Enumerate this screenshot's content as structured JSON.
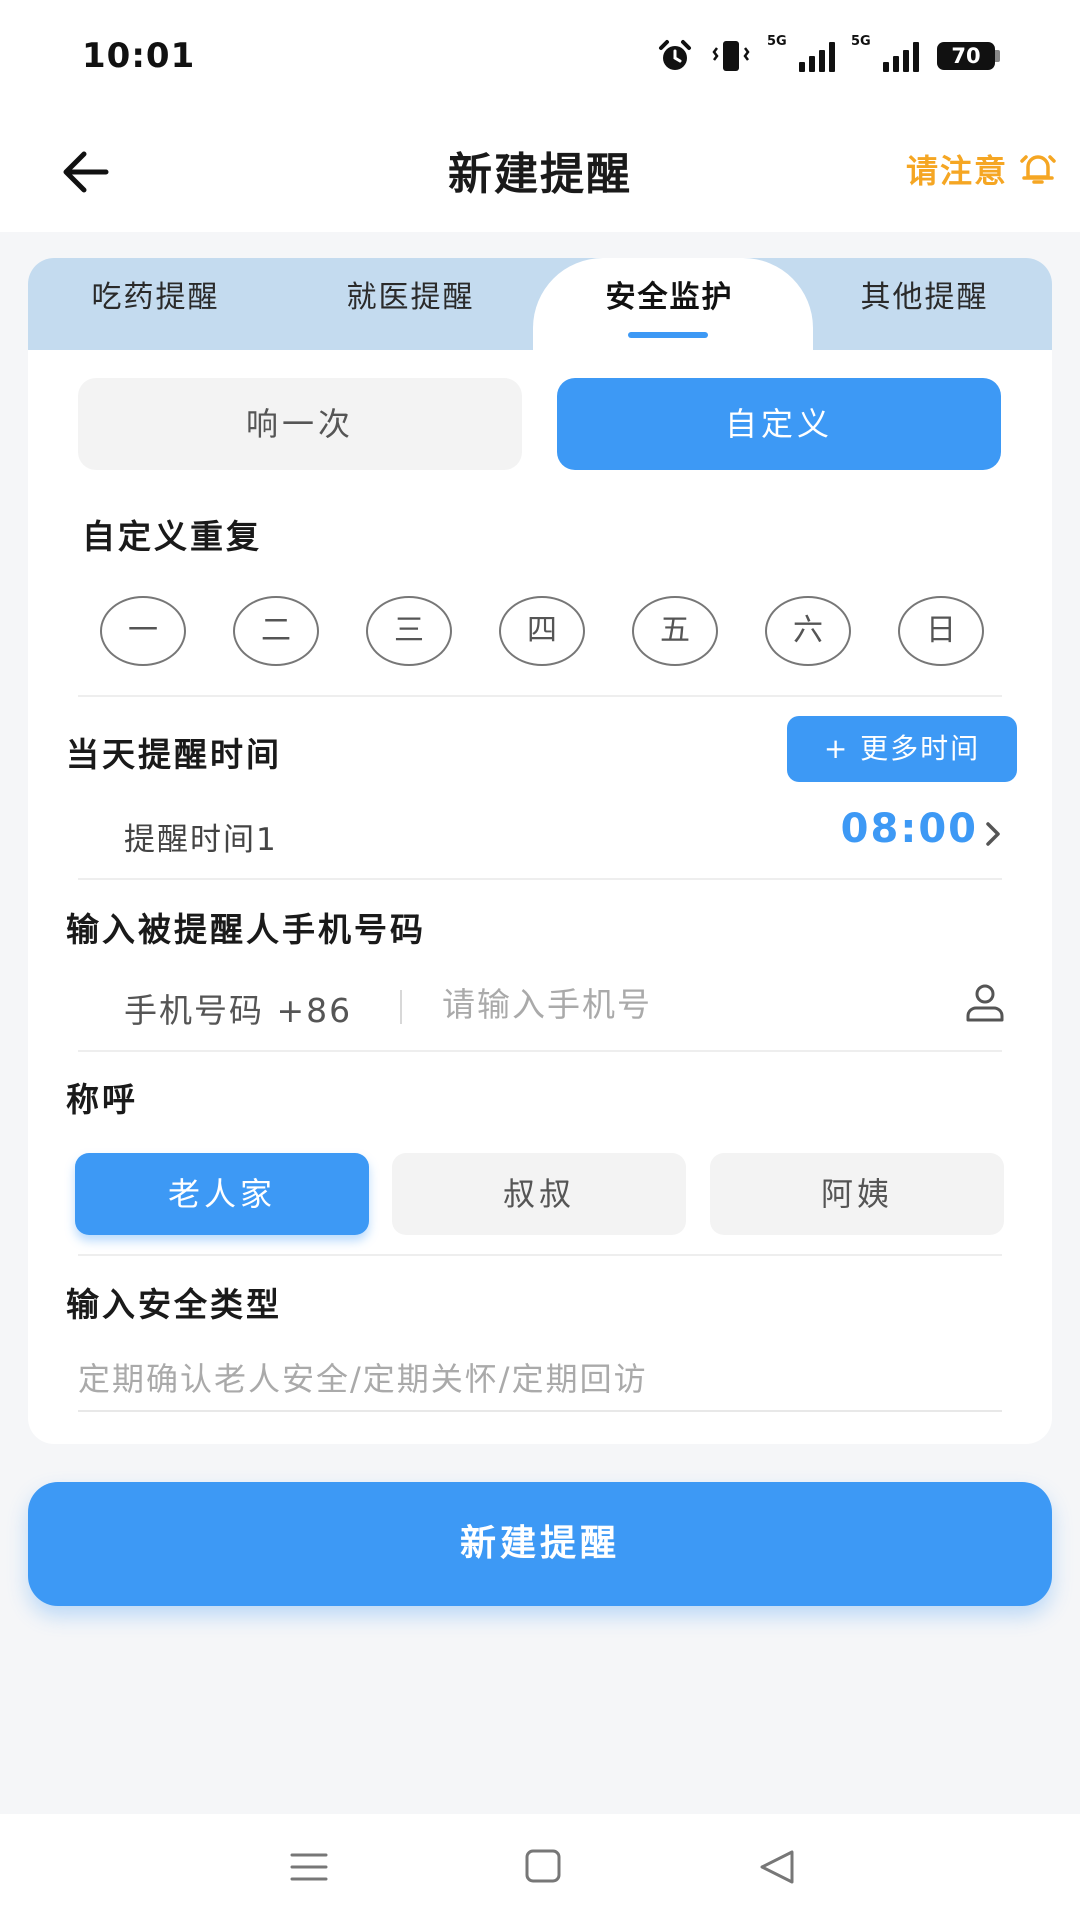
{
  "status_bar": {
    "time": "10:01",
    "icons": [
      "alarm-icon",
      "vibrate-icon",
      "signal-5g-icon",
      "signal-5g-icon",
      "battery-icon"
    ],
    "sim1_tag": "5G",
    "sim2_tag": "5G",
    "battery": "70"
  },
  "header": {
    "title": "新建提醒",
    "notice_label": "请注意",
    "icons": [
      "back-arrow-icon",
      "bell-icon"
    ]
  },
  "tabs": [
    {
      "label": "吃药提醒",
      "active": false
    },
    {
      "label": "就医提醒",
      "active": false
    },
    {
      "label": "安全监护",
      "active": true
    },
    {
      "label": "其他提醒",
      "active": false
    }
  ],
  "repeat_mode": {
    "once_label": "响一次",
    "custom_label": "自定义",
    "selected": "custom"
  },
  "custom_repeat": {
    "title": "自定义重复",
    "days": [
      "一",
      "二",
      "三",
      "四",
      "五",
      "六",
      "日"
    ]
  },
  "reminder_time": {
    "title": "当天提醒时间",
    "more_button": "+ 更多时间",
    "row_label": "提醒时间1",
    "value": "08:00"
  },
  "phone": {
    "title": "输入被提醒人手机号码",
    "prefix": "手机号码 +86",
    "placeholder": "请输入手机号",
    "value": ""
  },
  "salutation": {
    "title": "称呼",
    "options": [
      "老人家",
      "叔叔",
      "阿姨"
    ],
    "selected_index": 0
  },
  "safety_type": {
    "title": "输入安全类型",
    "placeholder": "定期确认老人安全/定期关怀/定期回访",
    "value": ""
  },
  "submit_label": "新建提醒",
  "colors": {
    "accent": "#3d99f5",
    "tab_bar": "#c4dbef",
    "notice": "#f5a623"
  },
  "navbar_icons": [
    "menu-icon",
    "home-square-icon",
    "back-triangle-icon"
  ]
}
